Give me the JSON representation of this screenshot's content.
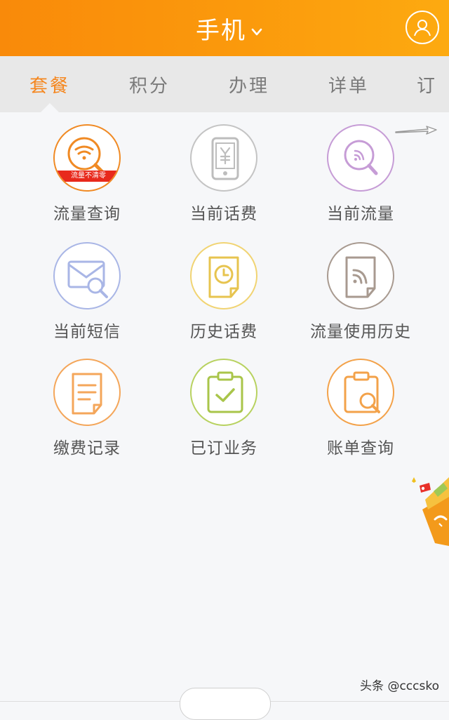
{
  "header": {
    "title": "手机",
    "accent": "#fb9a0c",
    "chevron_icon": "chevron-down-icon",
    "avatar_icon": "user-icon"
  },
  "tabs": [
    {
      "label": "套餐",
      "active": true
    },
    {
      "label": "积分",
      "active": false
    },
    {
      "label": "办理",
      "active": false
    },
    {
      "label": "详单",
      "active": false
    },
    {
      "label": "订",
      "active": false
    }
  ],
  "grid": [
    {
      "label": "流量查询",
      "icon": "data-search-icon",
      "color": "#f08a24",
      "badge": "流量不清零"
    },
    {
      "label": "当前话费",
      "icon": "phone-yuan-icon",
      "color": "#c4c4c4"
    },
    {
      "label": "当前流量",
      "icon": "data-magnifier-icon",
      "color": "#c69cd6"
    },
    {
      "label": "当前短信",
      "icon": "envelope-search-icon",
      "color": "#a9b6e6"
    },
    {
      "label": "历史话费",
      "icon": "clock-document-icon",
      "color": "#f1d473"
    },
    {
      "label": "流量使用历史",
      "icon": "data-document-icon",
      "color": "#a89a90"
    },
    {
      "label": "缴费记录",
      "icon": "payment-record-icon",
      "color": "#f4a65a"
    },
    {
      "label": "已订业务",
      "icon": "clipboard-check-icon",
      "color": "#b8d260"
    },
    {
      "label": "账单查询",
      "icon": "bill-search-icon",
      "color": "#f3a24a"
    }
  ],
  "watermark": "头条 @cccsko"
}
